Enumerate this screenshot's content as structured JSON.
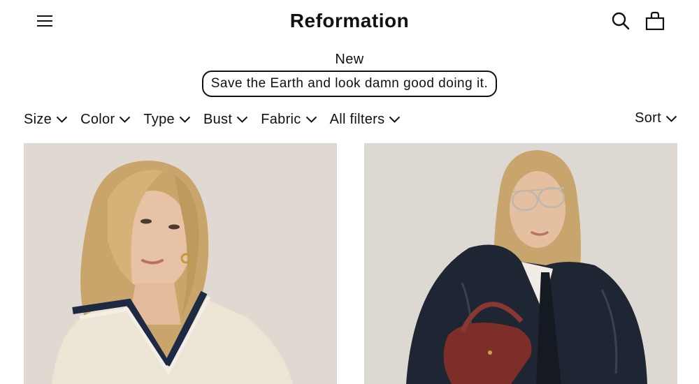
{
  "header": {
    "brand": "Reformation",
    "icons": [
      "menu-icon",
      "search-icon",
      "bag-icon"
    ]
  },
  "page": {
    "title": "New",
    "tagline": "Save the Earth and look damn good doing it."
  },
  "filters": [
    {
      "label": "Size"
    },
    {
      "label": "Color"
    },
    {
      "label": "Type"
    },
    {
      "label": "Bust"
    },
    {
      "label": "Fabric"
    },
    {
      "label": "All filters"
    }
  ],
  "sort": {
    "label": "Sort"
  },
  "products": [
    {
      "image": "woman-in-cream-cricket-sweater"
    },
    {
      "image": "woman-in-leather-jacket-with-red-bag"
    }
  ],
  "colors": {
    "text": "#111111",
    "background": "#ffffff",
    "photo_bg": "#dcd6cf"
  }
}
